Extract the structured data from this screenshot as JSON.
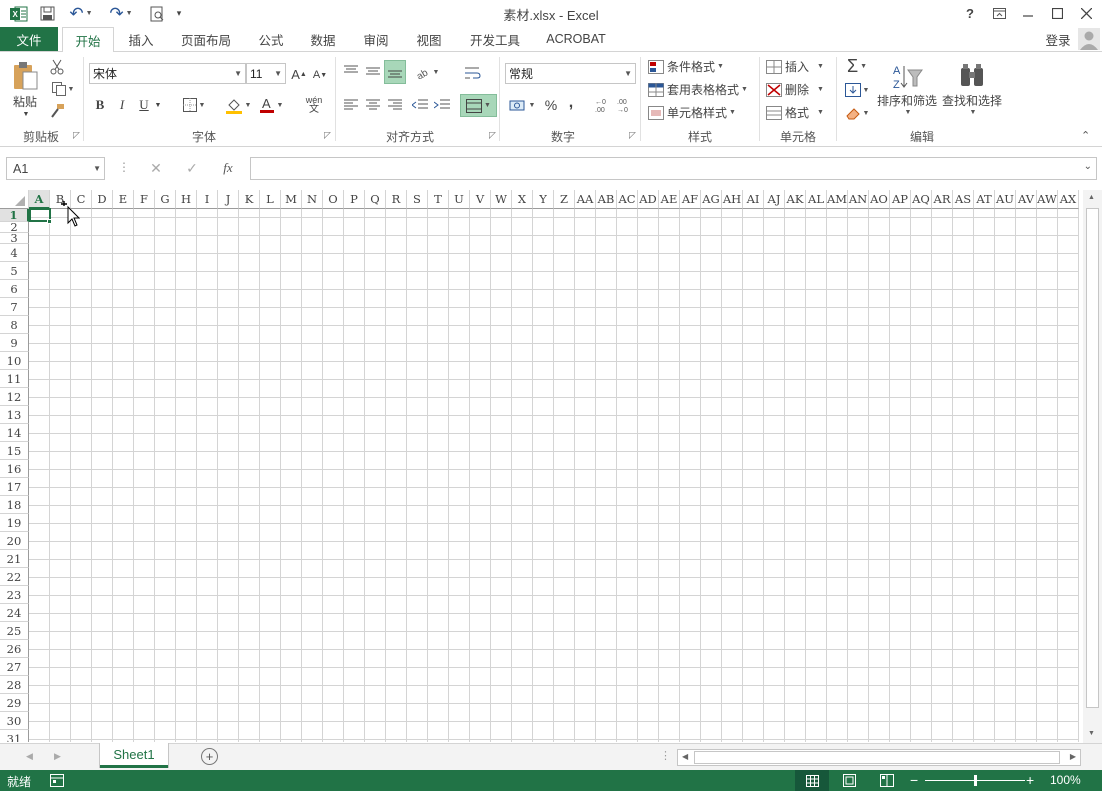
{
  "title_bar": {
    "title": "素材.xlsx - Excel",
    "help": "?",
    "login": "登录"
  },
  "tabs": {
    "file": "文件",
    "home": "开始",
    "insert": "插入",
    "layout": "页面布局",
    "formula": "公式",
    "data": "数据",
    "review": "审阅",
    "view": "视图",
    "developer": "开发工具",
    "acrobat": "ACROBAT"
  },
  "ribbon": {
    "clipboard": {
      "label": "剪贴板",
      "paste": "粘贴"
    },
    "font": {
      "label": "字体",
      "font_name": "宋体",
      "font_size": "11",
      "bold": "B",
      "italic": "I",
      "underline": "U",
      "wen": "wén"
    },
    "alignment": {
      "label": "对齐方式"
    },
    "number": {
      "label": "数字",
      "format": "常规",
      "percent": "%",
      "comma": ","
    },
    "styles": {
      "label": "样式",
      "conditional": "条件格式",
      "table_format": "套用表格格式",
      "cell_style": "单元格样式"
    },
    "cells": {
      "label": "单元格",
      "insert": "插入",
      "delete": "删除",
      "format": "格式"
    },
    "editing": {
      "label": "编辑",
      "sort": "排序和筛选",
      "find": "查找和选择"
    }
  },
  "formula_bar": {
    "name_box": "A1",
    "fx": "fx",
    "formula": ""
  },
  "grid": {
    "columns": [
      "A",
      "B",
      "C",
      "D",
      "E",
      "F",
      "G",
      "H",
      "I",
      "J",
      "K",
      "L",
      "M",
      "N",
      "O",
      "P",
      "Q",
      "R",
      "S",
      "T",
      "U",
      "V",
      "W",
      "X",
      "Y",
      "Z",
      "AA",
      "AB",
      "AC",
      "AD",
      "AE",
      "AF",
      "AG",
      "AH",
      "AI",
      "AJ",
      "AK",
      "AL",
      "AM",
      "AN",
      "AO",
      "AP",
      "AQ",
      "AR",
      "AS",
      "AT",
      "AU",
      "AV",
      "AW",
      "AX"
    ],
    "rows": [
      "1",
      "2",
      "3",
      "4",
      "5",
      "6",
      "7",
      "8",
      "9",
      "10",
      "11",
      "12",
      "13",
      "14",
      "15",
      "16",
      "17",
      "18",
      "19",
      "20",
      "21",
      "22",
      "23",
      "24",
      "25",
      "26",
      "27",
      "28",
      "29",
      "30",
      "31"
    ],
    "selected_cell": "A1"
  },
  "sheets": {
    "tabs": [
      "Sheet1"
    ],
    "active": "Sheet1"
  },
  "status_bar": {
    "status": "就绪",
    "zoom": "100%",
    "zoom_level": 0.5
  },
  "colors": {
    "accent": "#217346",
    "grid": "#d4d4d4"
  }
}
